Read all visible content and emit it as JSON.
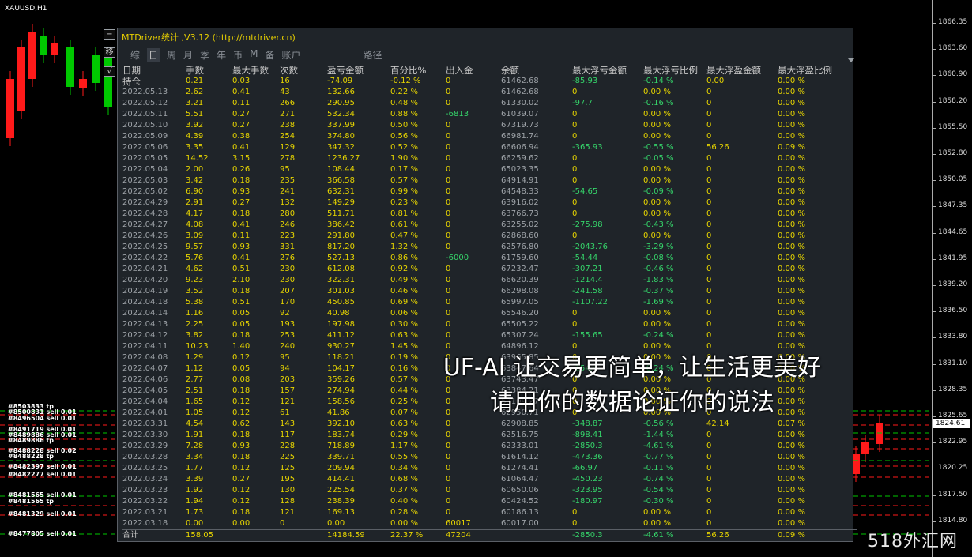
{
  "chart": {
    "symbol": "XAUUSD,H1",
    "price_ticks": [
      "1866.35",
      "1863.60",
      "1860.90",
      "1858.20",
      "1855.50",
      "1852.80",
      "1850.05",
      "1847.35",
      "1844.65",
      "1841.95",
      "1839.20",
      "1836.50",
      "1833.80",
      "1831.10",
      "1828.35",
      "1825.65",
      "1822.95",
      "1820.25",
      "1817.50",
      "1814.80"
    ],
    "current_price": "1824.61",
    "order_labels": [
      "#8503833 tp",
      "#8500831 sell 0.01",
      "#8496504 sell 0.01",
      "#8491719 sell 0.01",
      "#8489886 sell 0.01",
      "#8489886 tp",
      "#8488228 sell 0.02",
      "#8488228 tp",
      "#8482397 sell 0.01",
      "#8482277 sell 0.01",
      "#8481565 sell 0.01",
      "#8481565 tp",
      "#8481329 sell 0.01",
      "#8477805 sell 0.01"
    ]
  },
  "mini_buttons": [
    "−",
    "移",
    "√"
  ],
  "panel": {
    "title": "MTDriver统计 ,V3.12 (http://mtdriver.cn)",
    "tabs": [
      "综",
      "日",
      "周",
      "月",
      "季",
      "年",
      "币",
      "M",
      "备",
      "账户",
      "路径"
    ],
    "active_tab": "日",
    "headers": [
      "日期",
      "手数",
      "最大手数",
      "次数",
      "盈亏金额",
      "百分比%",
      "出入金",
      "余额",
      "最大浮亏金额",
      "最大浮亏比例",
      "最大浮盈金额",
      "最大浮盈比例"
    ],
    "holding": [
      "持仓",
      "0.21",
      "0.03",
      "16",
      "-74.09",
      "-0.12 %",
      "0",
      "61462.68",
      "-85.93",
      "-0.14 %",
      "0.00",
      "0.00 %"
    ],
    "rows": [
      [
        "2022.05.13",
        "2.62",
        "0.41",
        "43",
        "132.66",
        "0.22 %",
        "0",
        "61462.68",
        "0",
        "0.00 %",
        "0",
        "0.00 %"
      ],
      [
        "2022.05.12",
        "3.21",
        "0.11",
        "266",
        "290.95",
        "0.48 %",
        "0",
        "61330.02",
        "-97.7",
        "-0.16 %",
        "0",
        "0.00 %"
      ],
      [
        "2022.05.11",
        "5.51",
        "0.27",
        "271",
        "532.34",
        "0.88 %",
        "-6813",
        "61039.07",
        "0",
        "0.00 %",
        "0",
        "0.00 %"
      ],
      [
        "2022.05.10",
        "3.92",
        "0.27",
        "238",
        "337.99",
        "0.50 %",
        "0",
        "67319.73",
        "0",
        "0.00 %",
        "0",
        "0.00 %"
      ],
      [
        "2022.05.09",
        "4.39",
        "0.38",
        "254",
        "374.80",
        "0.56 %",
        "0",
        "66981.74",
        "0",
        "0.00 %",
        "0",
        "0.00 %"
      ],
      [
        "2022.05.06",
        "3.35",
        "0.41",
        "129",
        "347.32",
        "0.52 %",
        "0",
        "66606.94",
        "-365.93",
        "-0.55 %",
        "56.26",
        "0.09 %"
      ],
      [
        "2022.05.05",
        "14.52",
        "3.15",
        "278",
        "1236.27",
        "1.90 %",
        "0",
        "66259.62",
        "0",
        "-0.05 %",
        "0",
        "0.00 %"
      ],
      [
        "2022.05.04",
        "2.00",
        "0.26",
        "95",
        "108.44",
        "0.17 %",
        "0",
        "65023.35",
        "0",
        "0.00 %",
        "0",
        "0.00 %"
      ],
      [
        "2022.05.03",
        "3.42",
        "0.18",
        "235",
        "366.58",
        "0.57 %",
        "0",
        "64914.91",
        "0",
        "0.00 %",
        "0",
        "0.00 %"
      ],
      [
        "2022.05.02",
        "6.90",
        "0.93",
        "241",
        "632.31",
        "0.99 %",
        "0",
        "64548.33",
        "-54.65",
        "-0.09 %",
        "0",
        "0.00 %"
      ],
      [
        "2022.04.29",
        "2.91",
        "0.27",
        "132",
        "149.29",
        "0.23 %",
        "0",
        "63916.02",
        "0",
        "0.00 %",
        "0",
        "0.00 %"
      ],
      [
        "2022.04.28",
        "4.17",
        "0.18",
        "280",
        "511.71",
        "0.81 %",
        "0",
        "63766.73",
        "0",
        "0.00 %",
        "0",
        "0.00 %"
      ],
      [
        "2022.04.27",
        "4.08",
        "0.41",
        "246",
        "386.42",
        "0.61 %",
        "0",
        "63255.02",
        "-275.98",
        "-0.43 %",
        "0",
        "0.00 %"
      ],
      [
        "2022.04.26",
        "3.09",
        "0.11",
        "223",
        "291.80",
        "0.47 %",
        "0",
        "62868.60",
        "0",
        "0.00 %",
        "0",
        "0.00 %"
      ],
      [
        "2022.04.25",
        "9.57",
        "0.93",
        "331",
        "817.20",
        "1.32 %",
        "0",
        "62576.80",
        "-2043.76",
        "-3.29 %",
        "0",
        "0.00 %"
      ],
      [
        "2022.04.22",
        "5.76",
        "0.41",
        "276",
        "527.13",
        "0.86 %",
        "-6000",
        "61759.60",
        "-54.44",
        "-0.08 %",
        "0",
        "0.00 %"
      ],
      [
        "2022.04.21",
        "4.62",
        "0.51",
        "230",
        "612.08",
        "0.92 %",
        "0",
        "67232.47",
        "-307.21",
        "-0.46 %",
        "0",
        "0.00 %"
      ],
      [
        "2022.04.20",
        "9.23",
        "2.10",
        "230",
        "322.31",
        "0.49 %",
        "0",
        "66620.39",
        "-1214.4",
        "-1.83 %",
        "0",
        "0.00 %"
      ],
      [
        "2022.04.19",
        "3.52",
        "0.18",
        "207",
        "301.03",
        "0.46 %",
        "0",
        "66298.08",
        "-241.58",
        "-0.37 %",
        "0",
        "0.00 %"
      ],
      [
        "2022.04.18",
        "5.38",
        "0.51",
        "170",
        "450.85",
        "0.69 %",
        "0",
        "65997.05",
        "-1107.22",
        "-1.69 %",
        "0",
        "0.00 %"
      ],
      [
        "2022.04.14",
        "1.16",
        "0.05",
        "92",
        "40.98",
        "0.06 %",
        "0",
        "65546.20",
        "0",
        "0.00 %",
        "0",
        "0.00 %"
      ],
      [
        "2022.04.13",
        "2.25",
        "0.05",
        "193",
        "197.98",
        "0.30 %",
        "0",
        "65505.22",
        "0",
        "0.00 %",
        "0",
        "0.00 %"
      ],
      [
        "2022.04.12",
        "3.82",
        "0.18",
        "253",
        "411.12",
        "0.63 %",
        "0",
        "65307.24",
        "-155.65",
        "-0.24 %",
        "0",
        "0.00 %"
      ],
      [
        "2022.04.11",
        "10.23",
        "1.40",
        "240",
        "930.27",
        "1.45 %",
        "0",
        "64896.12",
        "0",
        "0.00 %",
        "0",
        "0.00 %"
      ],
      [
        "2022.04.08",
        "1.29",
        "0.12",
        "95",
        "118.21",
        "0.19 %",
        "0",
        "63965.85",
        "0",
        "0.00 %",
        "0",
        "0.00 %"
      ],
      [
        "2022.04.07",
        "1.12",
        "0.05",
        "94",
        "104.17",
        "0.16 %",
        "0",
        "63847.64",
        "-154.4",
        "-0.24 %",
        "0",
        "0.00 %"
      ],
      [
        "2022.04.06",
        "2.77",
        "0.08",
        "203",
        "359.26",
        "0.57 %",
        "0",
        "63743.47",
        "0",
        "0.00 %",
        "0",
        "0.00 %"
      ],
      [
        "2022.04.05",
        "2.51",
        "0.18",
        "157",
        "274.94",
        "0.44 %",
        "0",
        "63384.21",
        "0",
        "0.00 %",
        "0",
        "0.00 %"
      ],
      [
        "2022.04.04",
        "1.65",
        "0.12",
        "121",
        "158.56",
        "0.25 %",
        "0",
        "63109.27",
        "0",
        "0.00 %",
        "0",
        "0.00 %"
      ],
      [
        "2022.04.01",
        "1.05",
        "0.12",
        "61",
        "41.86",
        "0.07 %",
        "0",
        "62950.71",
        "0",
        "0.00 %",
        "0",
        "0.00 %"
      ],
      [
        "2022.03.31",
        "4.54",
        "0.62",
        "143",
        "392.10",
        "0.63 %",
        "0",
        "62908.85",
        "-348.87",
        "-0.56 %",
        "42.14",
        "0.07 %"
      ],
      [
        "2022.03.30",
        "1.91",
        "0.18",
        "117",
        "183.74",
        "0.29 %",
        "0",
        "62516.75",
        "-898.41",
        "-1.44 %",
        "0",
        "0.00 %"
      ],
      [
        "2022.03.29",
        "7.28",
        "0.93",
        "228",
        "718.89",
        "1.17 %",
        "0",
        "62333.01",
        "-2850.3",
        "-4.61 %",
        "0",
        "0.00 %"
      ],
      [
        "2022.03.28",
        "3.34",
        "0.18",
        "225",
        "339.71",
        "0.55 %",
        "0",
        "61614.12",
        "-473.36",
        "-0.77 %",
        "0",
        "0.00 %"
      ],
      [
        "2022.03.25",
        "1.77",
        "0.12",
        "125",
        "209.94",
        "0.34 %",
        "0",
        "61274.41",
        "-66.97",
        "-0.11 %",
        "0",
        "0.00 %"
      ],
      [
        "2022.03.24",
        "3.39",
        "0.27",
        "195",
        "414.41",
        "0.68 %",
        "0",
        "61064.47",
        "-450.23",
        "-0.74 %",
        "0",
        "0.00 %"
      ],
      [
        "2022.03.23",
        "1.92",
        "0.12",
        "130",
        "225.54",
        "0.37 %",
        "0",
        "60650.06",
        "-323.95",
        "-0.54 %",
        "0",
        "0.00 %"
      ],
      [
        "2022.03.22",
        "1.94",
        "0.12",
        "128",
        "238.39",
        "0.40 %",
        "0",
        "60424.52",
        "-180.97",
        "-0.30 %",
        "0",
        "0.00 %"
      ],
      [
        "2022.03.21",
        "1.73",
        "0.18",
        "121",
        "169.13",
        "0.28 %",
        "0",
        "60186.13",
        "0",
        "0.00 %",
        "0",
        "0.00 %"
      ],
      [
        "2022.03.18",
        "0.00",
        "0.00",
        "0",
        "0.00",
        "0.00 %",
        "60017",
        "60017.00",
        "0",
        "0.00 %",
        "0",
        "0.00 %"
      ]
    ],
    "totals": [
      "合计",
      "158.05",
      "",
      "",
      "14184.59",
      "22.37 %",
      "47204",
      "",
      "-2850.3",
      "-4.61 %",
      "56.26",
      "0.09 %"
    ]
  },
  "overlay": {
    "line1": "UF-AI 让交易更简单，让生活更美好",
    "line2": "请用你的数据论证你的说法"
  },
  "watermark": "518外汇网",
  "colors": {
    "up": "#00c800",
    "down": "#ff1a1a",
    "yellow": "#e6d400",
    "green": "#35d46a"
  }
}
